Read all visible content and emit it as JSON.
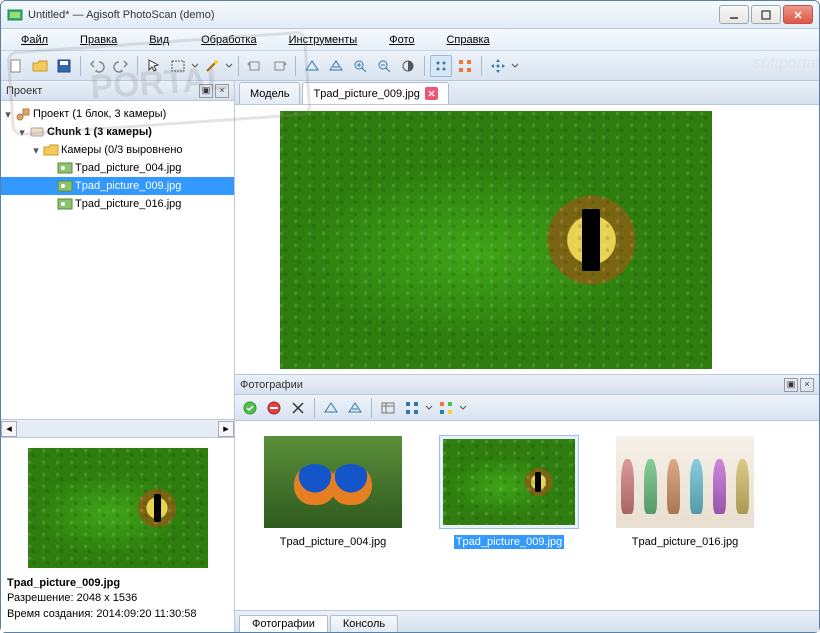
{
  "window": {
    "title": "Untitled* — Agisoft PhotoScan (demo)"
  },
  "menu": {
    "file": "Файл",
    "edit": "Правка",
    "view": "Вид",
    "process": "Обработка",
    "tools": "Инструменты",
    "photo": "Фото",
    "help": "Справка"
  },
  "project_panel": {
    "title": "Проект",
    "root": "Проект (1 блок, 3 камеры)",
    "chunk": "Chunk 1 (3 камеры)",
    "cameras_group": "Камеры (0/3 выровнено",
    "cameras": [
      "Tpad_picture_004.jpg",
      "Tpad_picture_009.jpg",
      "Tpad_picture_016.jpg"
    ]
  },
  "preview": {
    "filename": "Tpad_picture_009.jpg",
    "resolution_label": "Разрешение: 2048 x 1536",
    "created_label": "Время создания: 2014:09:20 11:30:58"
  },
  "tabs": {
    "model": "Модель",
    "active_image": "Tpad_picture_009.jpg"
  },
  "photos_panel": {
    "title": "Фотографии",
    "items": [
      {
        "name": "Tpad_picture_004.jpg"
      },
      {
        "name": "Tpad_picture_009.jpg"
      },
      {
        "name": "Tpad_picture_016.jpg"
      }
    ]
  },
  "bottom_tabs": {
    "photos": "Фотографии",
    "console": "Консоль"
  }
}
